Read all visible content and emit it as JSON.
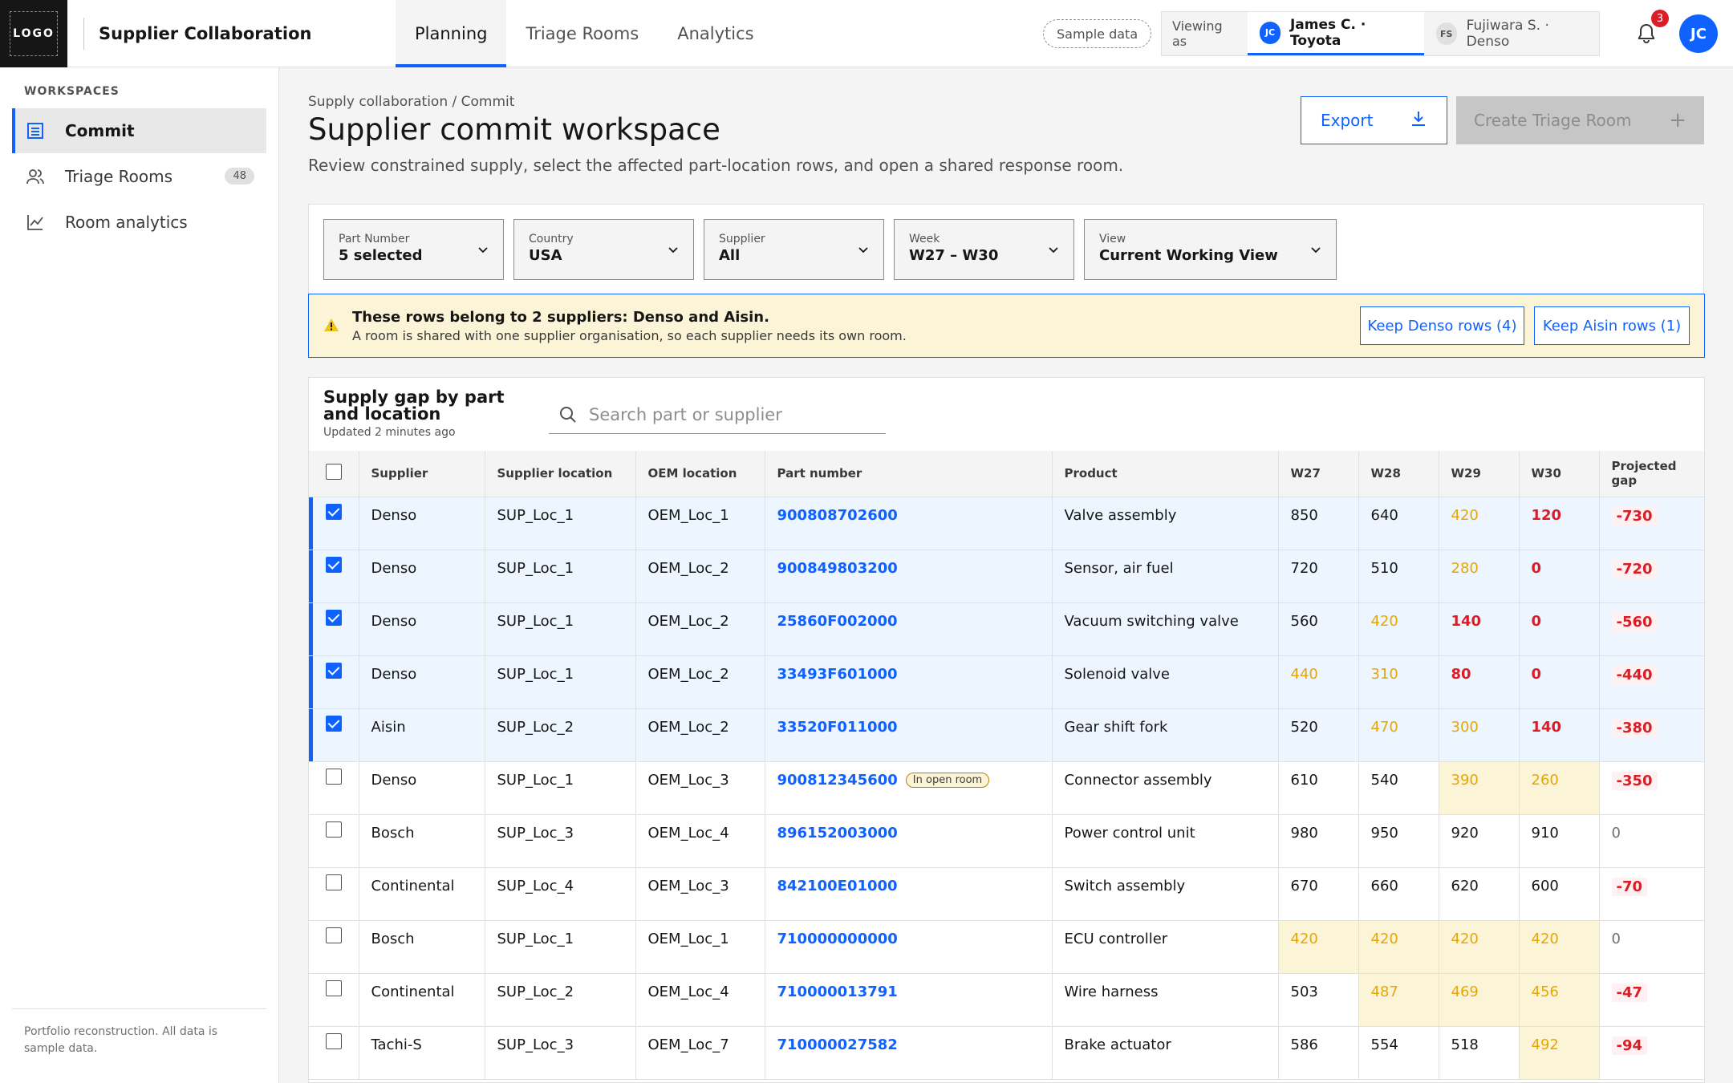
{
  "header": {
    "logo": "LOGO",
    "app_title": "Supplier Collaboration",
    "tabs": [
      {
        "label": "Planning"
      },
      {
        "label": "Triage Rooms"
      },
      {
        "label": "Analytics"
      }
    ],
    "sample_badge": "Sample data",
    "viewing_as_label": "Viewing as",
    "users": [
      {
        "initials": "JC",
        "label": "James C. · Toyota"
      },
      {
        "initials": "FS",
        "label": "Fujiwara S. · Denso"
      }
    ],
    "notification_count": "3",
    "avatar_initials": "JC"
  },
  "sidebar": {
    "section_label": "WORKSPACES",
    "items": [
      {
        "label": "Commit",
        "icon": "list-icon"
      },
      {
        "label": "Triage Rooms",
        "icon": "people-icon",
        "count": "48"
      },
      {
        "label": "Room analytics",
        "icon": "chart-icon"
      }
    ],
    "footer": "Portfolio reconstruction. All data is sample data."
  },
  "main": {
    "breadcrumb": "Supply collaboration / Commit",
    "title": "Supplier commit workspace",
    "subtitle": "Review constrained supply, select the affected part-location rows, and open a shared response room.",
    "export_label": "Export",
    "create_label": "Create Triage Room"
  },
  "filters": [
    {
      "label": "Part Number",
      "value": "5 selected"
    },
    {
      "label": "Country",
      "value": "USA"
    },
    {
      "label": "Supplier",
      "value": "All"
    },
    {
      "label": "Week",
      "value": "W27 – W30"
    },
    {
      "label": "View",
      "value": "Current Working View"
    }
  ],
  "warning": {
    "title": "These rows belong to 2 suppliers: Denso and Aisin.",
    "text": "A room is shared with one supplier organisation, so each supplier needs its own room.",
    "keep_denso": "Keep Denso rows (4)",
    "keep_aisin": "Keep Aisin rows (1)"
  },
  "table": {
    "title": "Supply gap by part and location",
    "updated": "Updated 2 minutes ago",
    "search_placeholder": "Search part or supplier",
    "columns": [
      "Supplier",
      "Supplier location",
      "OEM location",
      "Part number",
      "Product",
      "W27",
      "W28",
      "W29",
      "W30",
      "Projected gap"
    ],
    "open_room_tag": "In open room",
    "rows": [
      {
        "selected": true,
        "supplier": "Denso",
        "sup_loc": "SUP_Loc_1",
        "oem_loc": "OEM_Loc_1",
        "part": "900808702600",
        "product": "Valve assembly",
        "w27": "850",
        "w28": "640",
        "w29": "420",
        "w30": "120",
        "gap": "-730",
        "open_room": false,
        "styles": [
          "n",
          "n",
          "amber",
          "red"
        ],
        "hl": [
          false,
          false,
          false,
          false
        ]
      },
      {
        "selected": true,
        "supplier": "Denso",
        "sup_loc": "SUP_Loc_1",
        "oem_loc": "OEM_Loc_2",
        "part": "900849803200",
        "product": "Sensor, air fuel",
        "w27": "720",
        "w28": "510",
        "w29": "280",
        "w30": "0",
        "gap": "-720",
        "open_room": false,
        "styles": [
          "n",
          "n",
          "amber",
          "red"
        ],
        "hl": [
          false,
          false,
          false,
          false
        ]
      },
      {
        "selected": true,
        "supplier": "Denso",
        "sup_loc": "SUP_Loc_1",
        "oem_loc": "OEM_Loc_2",
        "part": "25860F002000",
        "product": "Vacuum switching valve",
        "w27": "560",
        "w28": "420",
        "w29": "140",
        "w30": "0",
        "gap": "-560",
        "open_room": false,
        "styles": [
          "n",
          "amber",
          "red",
          "red"
        ],
        "hl": [
          false,
          false,
          false,
          false
        ]
      },
      {
        "selected": true,
        "supplier": "Denso",
        "sup_loc": "SUP_Loc_1",
        "oem_loc": "OEM_Loc_2",
        "part": "33493F601000",
        "product": "Solenoid valve",
        "w27": "440",
        "w28": "310",
        "w29": "80",
        "w30": "0",
        "gap": "-440",
        "open_room": false,
        "styles": [
          "amber",
          "amber",
          "red",
          "red"
        ],
        "hl": [
          false,
          false,
          false,
          false
        ]
      },
      {
        "selected": true,
        "supplier": "Aisin",
        "sup_loc": "SUP_Loc_2",
        "oem_loc": "OEM_Loc_2",
        "part": "33520F011000",
        "product": "Gear shift fork",
        "w27": "520",
        "w28": "470",
        "w29": "300",
        "w30": "140",
        "gap": "-380",
        "open_room": false,
        "styles": [
          "n",
          "amber",
          "amber",
          "red"
        ],
        "hl": [
          false,
          false,
          false,
          false
        ]
      },
      {
        "selected": false,
        "supplier": "Denso",
        "sup_loc": "SUP_Loc_1",
        "oem_loc": "OEM_Loc_3",
        "part": "900812345600",
        "product": "Connector assembly",
        "w27": "610",
        "w28": "540",
        "w29": "390",
        "w30": "260",
        "gap": "-350",
        "open_room": true,
        "styles": [
          "n",
          "n",
          "amber",
          "amber"
        ],
        "hl": [
          false,
          false,
          true,
          true
        ]
      },
      {
        "selected": false,
        "supplier": "Bosch",
        "sup_loc": "SUP_Loc_3",
        "oem_loc": "OEM_Loc_4",
        "part": "896152003000",
        "product": "Power control unit",
        "w27": "980",
        "w28": "950",
        "w29": "920",
        "w30": "910",
        "gap": "0",
        "open_room": false,
        "styles": [
          "n",
          "n",
          "n",
          "n"
        ],
        "hl": [
          false,
          false,
          false,
          false
        ]
      },
      {
        "selected": false,
        "supplier": "Continental",
        "sup_loc": "SUP_Loc_4",
        "oem_loc": "OEM_Loc_3",
        "part": "842100E01000",
        "product": "Switch assembly",
        "w27": "670",
        "w28": "660",
        "w29": "620",
        "w30": "600",
        "gap": "-70",
        "open_room": false,
        "styles": [
          "n",
          "n",
          "n",
          "n"
        ],
        "hl": [
          false,
          false,
          false,
          false
        ]
      },
      {
        "selected": false,
        "supplier": "Bosch",
        "sup_loc": "SUP_Loc_1",
        "oem_loc": "OEM_Loc_1",
        "part": "710000000000",
        "product": "ECU controller",
        "w27": "420",
        "w28": "420",
        "w29": "420",
        "w30": "420",
        "gap": "0",
        "open_room": false,
        "styles": [
          "amber",
          "amber",
          "amber",
          "amber"
        ],
        "hl": [
          true,
          true,
          true,
          true
        ]
      },
      {
        "selected": false,
        "supplier": "Continental",
        "sup_loc": "SUP_Loc_2",
        "oem_loc": "OEM_Loc_4",
        "part": "710000013791",
        "product": "Wire harness",
        "w27": "503",
        "w28": "487",
        "w29": "469",
        "w30": "456",
        "gap": "-47",
        "open_room": false,
        "styles": [
          "n",
          "amber",
          "amber",
          "amber"
        ],
        "hl": [
          false,
          true,
          true,
          true
        ]
      },
      {
        "selected": false,
        "supplier": "Tachi-S",
        "sup_loc": "SUP_Loc_3",
        "oem_loc": "OEM_Loc_7",
        "part": "710000027582",
        "product": "Brake actuator",
        "w27": "586",
        "w28": "554",
        "w29": "518",
        "w30": "492",
        "gap": "-94",
        "open_room": false,
        "styles": [
          "n",
          "n",
          "n",
          "amber"
        ],
        "hl": [
          false,
          false,
          false,
          true
        ]
      }
    ]
  },
  "colors": {
    "accent": "#0f62fe",
    "amber": "#e5a708",
    "red": "#da1e28",
    "warning_bg": "#fcf4d6"
  }
}
